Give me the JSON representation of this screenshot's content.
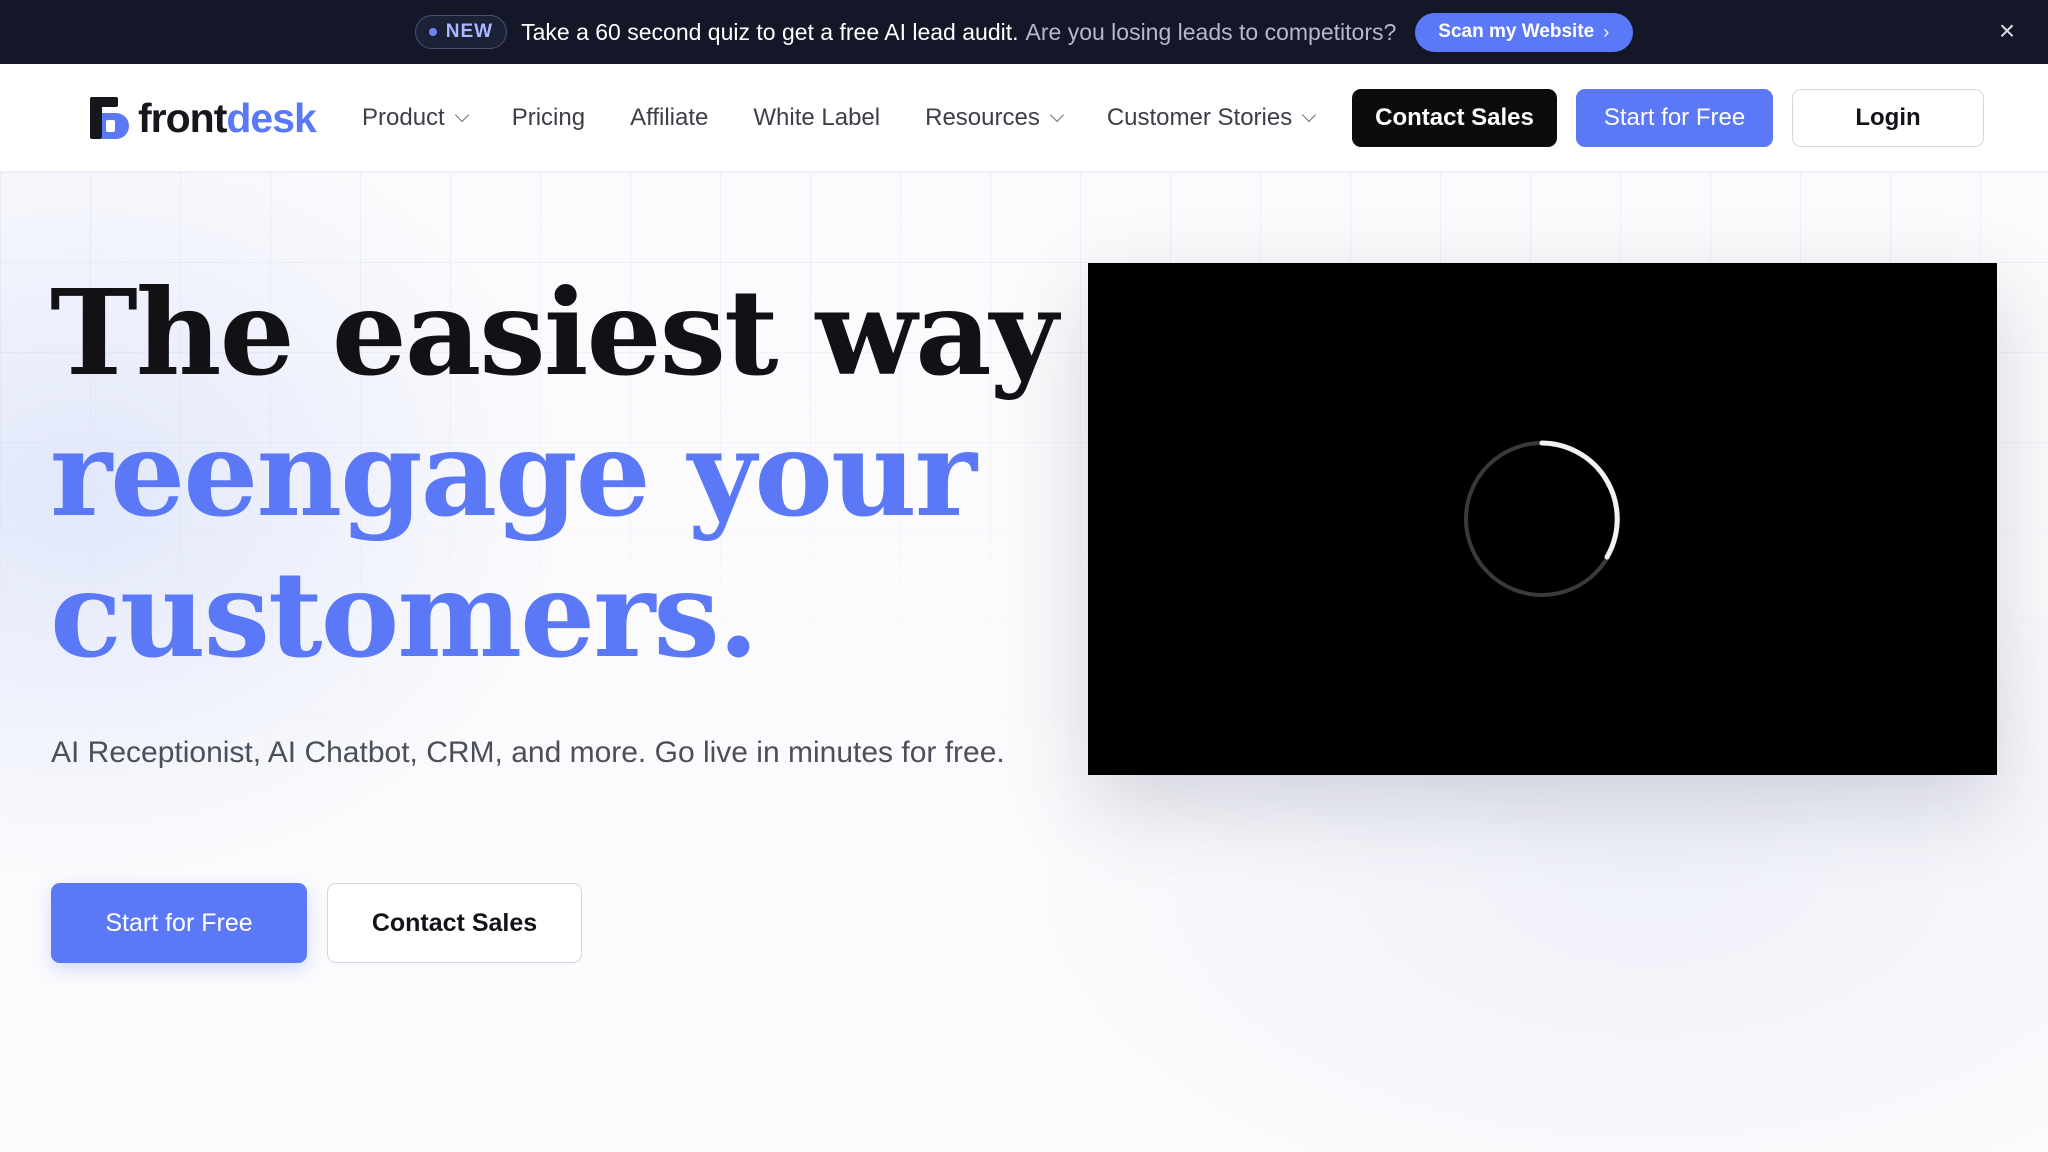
{
  "announcement": {
    "badge": "NEW",
    "text": "Take a 60 second quiz to get a free AI lead audit.",
    "subtext": "Are you losing leads to competitors?",
    "cta": "Scan my Website",
    "cta_icon": "chevron-right-icon",
    "close_icon": "close-icon"
  },
  "nav": {
    "logo": {
      "front": "front",
      "desk": "desk"
    },
    "links": [
      "Product",
      "Pricing",
      "Affiliate",
      "White Label",
      "Resources",
      "Customer Stories"
    ],
    "dropdown_links": [
      "Product",
      "Resources",
      "Customer Stories"
    ],
    "contact_sales": "Contact Sales",
    "start_free": "Start for Free",
    "login": "Login"
  },
  "hero": {
    "headline_line1": "The easiest way to",
    "headline_line2": "reengage your",
    "headline_line3": "customers.",
    "subtext": "AI Receptionist, AI Chatbot, CRM, and more. Go live in minutes for free.",
    "primary_cta": "Start for Free",
    "secondary_cta": "Contact Sales",
    "video_state_icon": "loading-spinner-icon"
  },
  "colors": {
    "accent": "#5b78f6",
    "announcement_bg": "#131728",
    "dark_button": "#0c0c0f",
    "video_bg": "#000000"
  }
}
